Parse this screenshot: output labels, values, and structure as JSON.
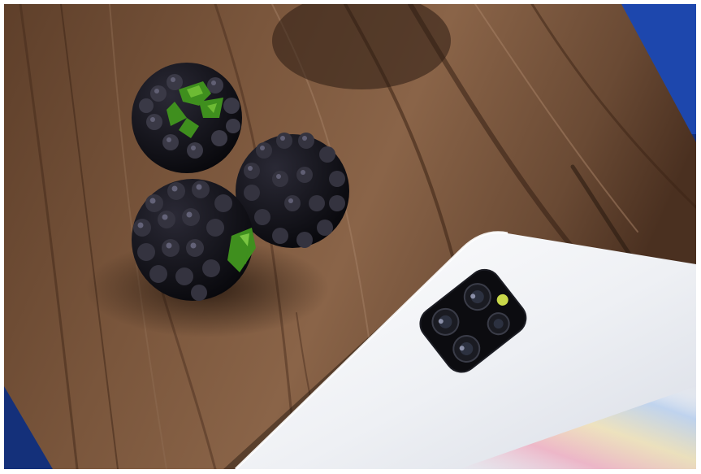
{
  "image": {
    "subject": "photo",
    "colors": {
      "background_blue": "#1b3f9a",
      "wood_dark": "#3a2418",
      "wood_mid": "#6b4a34",
      "wood_light": "#9a7a60",
      "berry": "#121118",
      "berry_highlight": "#5a5870",
      "leaf": "#3f8f1e",
      "phone_body": "#eceef2",
      "camera_module": "#0c0c10",
      "lens_ring": "#2b2d36",
      "flash": "#c9d84a"
    }
  }
}
